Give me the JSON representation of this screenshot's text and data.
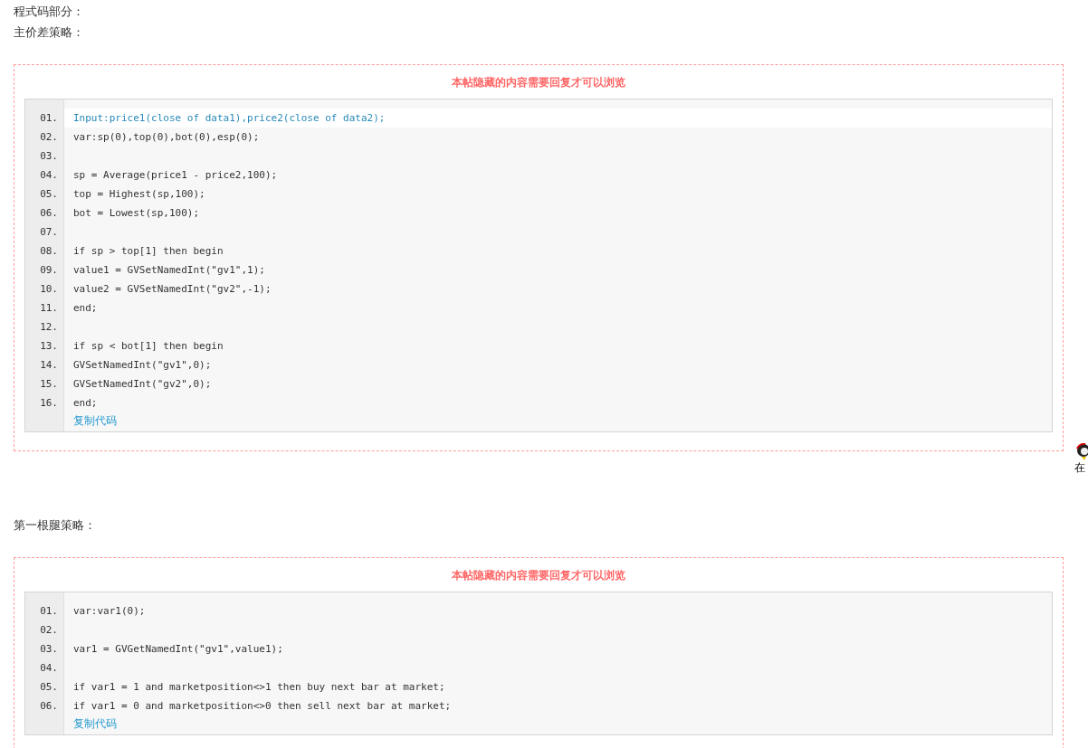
{
  "intro_lines": [
    "程式码部分：",
    "主价差策略："
  ],
  "sections": [
    {
      "notice": "本帖隐藏的内容需要回复才可以浏览",
      "lines": [
        {
          "number": "01.",
          "code": "Input:price1(close of data1),price2(close of data2);",
          "highlighted": true
        },
        {
          "number": "02.",
          "code": "var:sp(0),top(0),bot(0),esp(0);",
          "highlighted": false
        },
        {
          "number": "03."
        },
        {
          "number": "04.",
          "code": "sp = Average(price1 - price2,100);",
          "highlighted": false
        },
        {
          "number": "05.",
          "code": "top = Highest(sp,100);",
          "highlighted": false
        },
        {
          "number": "06.",
          "code": "bot = Lowest(sp,100);",
          "highlighted": false
        },
        {
          "number": "07."
        },
        {
          "number": "08.",
          "code": "if sp > top[1] then begin",
          "highlighted": false
        },
        {
          "number": "09.",
          "code": "value1 = GVSetNamedInt(\"gv1\",1);",
          "highlighted": false
        },
        {
          "number": "10.",
          "code": "value2 = GVSetNamedInt(\"gv2\",-1);",
          "highlighted": false
        },
        {
          "number": "11.",
          "code": "end;",
          "highlighted": false
        },
        {
          "number": "12."
        },
        {
          "number": "13.",
          "code": "if sp < bot[1] then begin",
          "highlighted": false
        },
        {
          "number": "14.",
          "code": "GVSetNamedInt(\"gv1\",0);",
          "highlighted": false
        },
        {
          "number": "15.",
          "code": "GVSetNamedInt(\"gv2\",0);",
          "highlighted": false
        },
        {
          "number": "16.",
          "code": "end;",
          "highlighted": false
        }
      ],
      "copy_link": "复制代码"
    },
    {
      "heading": "第一根腿策略：",
      "notice": "本帖隐藏的内容需要回复才可以浏览",
      "lines": [
        {
          "number": "01.",
          "code": "var:var1(0);",
          "highlighted": false
        },
        {
          "number": "02."
        },
        {
          "number": "03.",
          "code": "var1 = GVGetNamedInt(\"gv1\",value1);",
          "highlighted": false
        },
        {
          "number": "04."
        },
        {
          "number": "05.",
          "code": "if var1 = 1 and marketposition<>1 then buy next bar at market;",
          "highlighted": false
        },
        {
          "number": "06.",
          "code": "if var1 = 0 and marketposition<>0 then sell next bar at market;",
          "highlighted": false
        }
      ],
      "copy_link": "复制代码"
    }
  ],
  "floating_widget": {
    "label": "在"
  }
}
